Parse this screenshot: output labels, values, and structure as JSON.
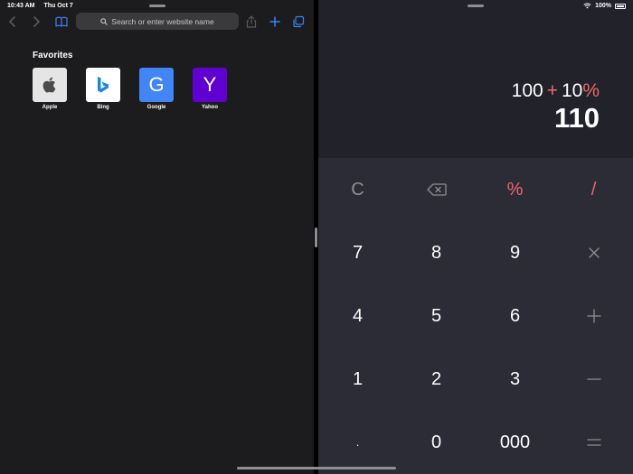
{
  "status_bar": {
    "time": "10:43 AM",
    "date": "Thu Oct 7",
    "battery": "100%"
  },
  "safari": {
    "address_placeholder": "Search or enter website name",
    "favorites_title": "Favorites",
    "favorites": [
      {
        "label": "Apple",
        "glyph": "",
        "color": "#e5e5e5"
      },
      {
        "label": "Bing",
        "glyph": "b",
        "color": "#ffffff"
      },
      {
        "label": "Google",
        "glyph": "G",
        "color": "#4285f4"
      },
      {
        "label": "Yahoo",
        "glyph": "Y",
        "color": "#6001d2"
      }
    ],
    "icons": [
      "back-icon",
      "forward-icon",
      "bookmarks-icon",
      "share-icon",
      "new-tab-icon",
      "tabs-icon"
    ]
  },
  "calculator": {
    "expression": {
      "operand1": "100",
      "operator": "+",
      "operand2": "10",
      "suffix": "%"
    },
    "result": "110",
    "accent_color": "#f0696b",
    "keys": {
      "clear": "C",
      "percent": "%",
      "divide": "/",
      "seven": "7",
      "eight": "8",
      "nine": "9",
      "four": "4",
      "five": "5",
      "six": "6",
      "one": "1",
      "two": "2",
      "three": "3",
      "decimal": ".",
      "zero": "0",
      "triple_zero": "000"
    }
  }
}
